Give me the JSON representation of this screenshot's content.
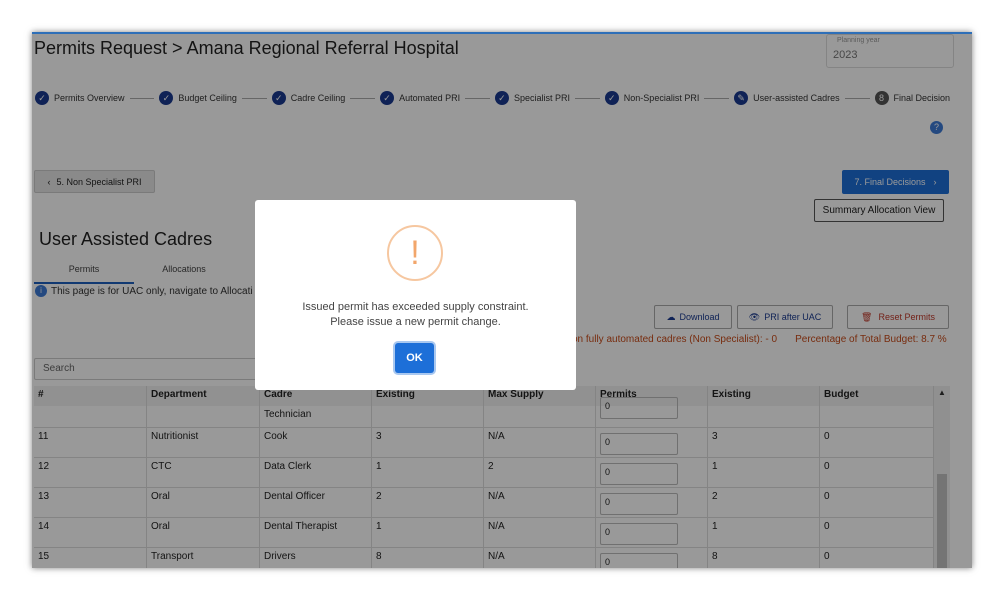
{
  "page_title": "Permits Request > Amana Regional Referral Hospital",
  "planning_year": {
    "label": "Planning year",
    "value": "2023"
  },
  "steps": [
    {
      "label": "Permits Overview"
    },
    {
      "label": "Budget Ceiling"
    },
    {
      "label": "Cadre Ceiling"
    },
    {
      "label": "Automated PRI"
    },
    {
      "label": "Specialist PRI"
    },
    {
      "label": "Non-Specialist PRI"
    },
    {
      "label": "User-assisted Cadres"
    },
    {
      "label": "Final Decision",
      "number": "8"
    }
  ],
  "nav": {
    "back_label": "5. Non Specialist PRI",
    "next_label": "7. Final Decisions",
    "summary_label": "Summary Allocation View"
  },
  "section_title": "User Assisted Cadres",
  "tabs": [
    {
      "label": "Permits"
    },
    {
      "label": "Allocations"
    }
  ],
  "info_text": "This page is for UAC only, navigate to Allocati",
  "actions": {
    "download": "Download",
    "pri_after_uac": "PRI after UAC",
    "reset": "Reset Permits"
  },
  "stats": {
    "left": "on fully automated cadres (Non Specialist): - 0",
    "right": "Percentage of Total Budget: 8.7 %"
  },
  "search": {
    "placeholder": "Search"
  },
  "table": {
    "headers": [
      "#",
      "Department",
      "Cadre",
      "Existing",
      "Max Supply",
      "Permits",
      "Existing",
      "Budget"
    ],
    "partial_row": {
      "cadre": "Technician",
      "permit": "0"
    },
    "rows": [
      {
        "num": "11",
        "dept": "Nutritionist",
        "cadre": "Cook",
        "existing": "3",
        "max": "N/A",
        "permit": "0",
        "existing2": "3",
        "budget": "0"
      },
      {
        "num": "12",
        "dept": "CTC",
        "cadre": "Data Clerk",
        "existing": "1",
        "max": "2",
        "permit": "0",
        "existing2": "1",
        "budget": "0"
      },
      {
        "num": "13",
        "dept": "Oral",
        "cadre": "Dental Officer",
        "existing": "2",
        "max": "N/A",
        "permit": "0",
        "existing2": "2",
        "budget": "0"
      },
      {
        "num": "14",
        "dept": "Oral",
        "cadre": "Dental Therapist",
        "existing": "1",
        "max": "N/A",
        "permit": "0",
        "existing2": "1",
        "budget": "0"
      },
      {
        "num": "15",
        "dept": "Transport",
        "cadre": "Drivers",
        "existing": "8",
        "max": "N/A",
        "permit": "0",
        "existing2": "8",
        "budget": "0"
      }
    ]
  },
  "modal": {
    "icon": "!",
    "line1": "Issued permit has exceeded supply constraint.",
    "line2": "Please issue a new permit change.",
    "ok_label": "OK"
  },
  "colors": {
    "primary": "#1d6fd8",
    "stepper": "#1a3a8f",
    "warning": "#f2a66b",
    "stats": "#c84b1a"
  }
}
